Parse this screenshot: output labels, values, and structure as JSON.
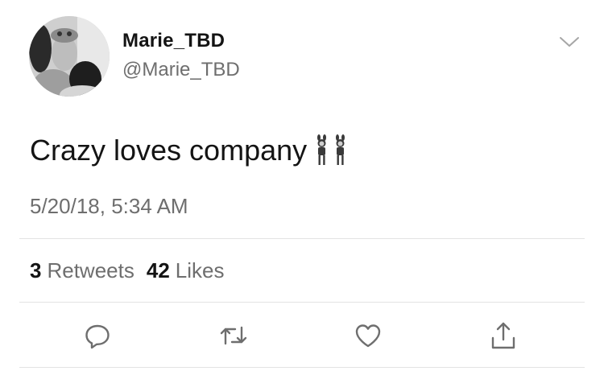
{
  "user": {
    "display_name": "Marie_TBD",
    "handle": "@Marie_TBD"
  },
  "tweet": {
    "text": "Crazy loves company",
    "emoji": "women-with-bunny-ears-emoji",
    "timestamp": "5/20/18, 5:34 AM"
  },
  "stats": {
    "retweets_count": "3",
    "retweets_label": "Retweets",
    "likes_count": "42",
    "likes_label": "Likes"
  },
  "actions": [
    {
      "name": "reply",
      "icon": "speech-bubble-icon"
    },
    {
      "name": "retweet",
      "icon": "retweet-arrows-icon"
    },
    {
      "name": "like",
      "icon": "heart-icon"
    },
    {
      "name": "share",
      "icon": "share-up-arrow-icon"
    }
  ],
  "colors": {
    "text_primary": "#141414",
    "text_secondary": "#6e6e6e",
    "divider": "#e3e3e3",
    "icon": "#6e6e6e"
  }
}
